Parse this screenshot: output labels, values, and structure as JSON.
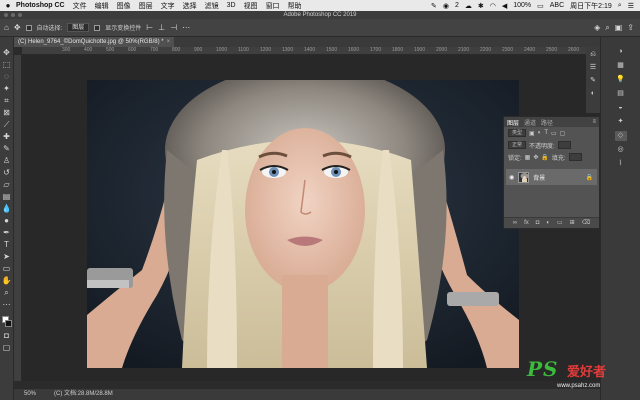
{
  "menubar": {
    "app_name": "Photoshop CC",
    "items": [
      "文件",
      "编辑",
      "图像",
      "图层",
      "文字",
      "选择",
      "滤镜",
      "3D",
      "视图",
      "窗口",
      "帮助"
    ],
    "badge_count": "2",
    "battery": "100%",
    "clock": "周日下午2:19",
    "user_badge": "ABC"
  },
  "titlebar": {
    "title": "Adobe Photoshop CC 2019"
  },
  "options": {
    "auto_select_label": "自动选择:",
    "auto_select_value": "图层",
    "show_transform_label": "显示变换控件"
  },
  "document": {
    "tab_label": "(C) Helen_9764_©DomQuichotte.jpg @ 50%(RGB/8) *",
    "close": "×",
    "ruler_marks": [
      "300",
      "400",
      "500",
      "600",
      "700",
      "800",
      "900",
      "1000",
      "1100",
      "1200",
      "1300",
      "1400",
      "1500",
      "1600",
      "1700",
      "1800",
      "1900",
      "2000",
      "2100",
      "2200",
      "2300",
      "2400",
      "2500",
      "2600",
      "2700"
    ]
  },
  "status": {
    "zoom": "50%",
    "doc_info": "(C) 文档:28.8M/28.8M"
  },
  "layers_panel": {
    "tabs": [
      "图层",
      "通道",
      "路径"
    ],
    "kind_label": "类型",
    "mode_label": "正常",
    "opacity_label": "不透明度:",
    "lock_label": "锁定:",
    "fill_label": "填充:",
    "layer_name": "背景"
  },
  "watermark": {
    "logo": "PS",
    "brand": "爱好者",
    "url": "www.psahz.com"
  },
  "icons": {
    "move_tool": "move-icon",
    "lock": "lock-icon",
    "eye": "eye-icon"
  }
}
